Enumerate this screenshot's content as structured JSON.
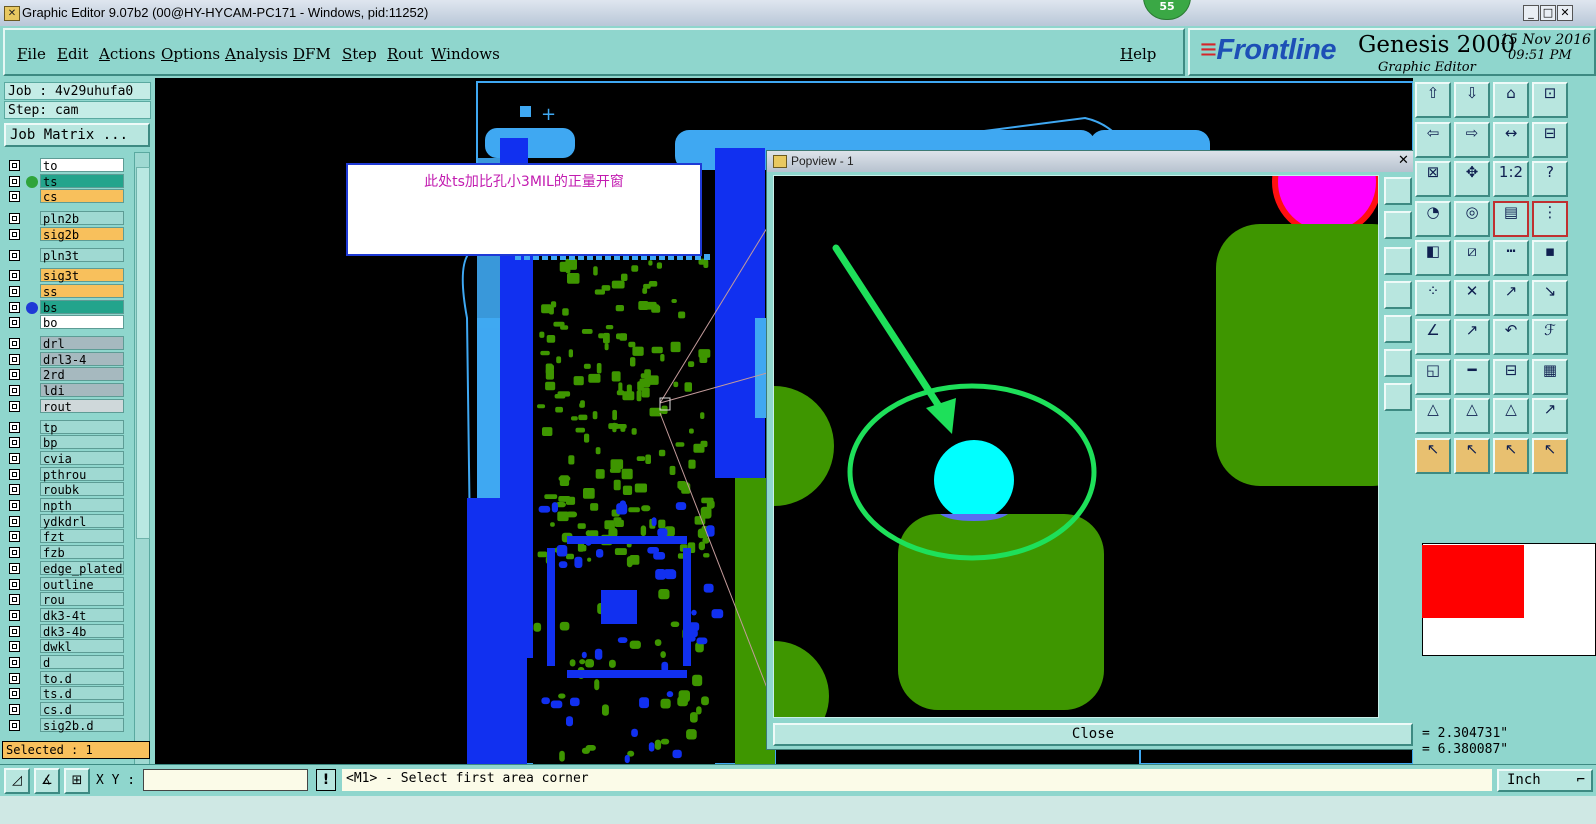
{
  "window": {
    "title": "Graphic Editor 9.07b2 (00@HY-HYCAM-PC171 - Windows, pid:11252)",
    "badge": "55",
    "min_icon": "minimize-icon",
    "max_icon": "maximize-icon",
    "close_icon": "close-icon"
  },
  "menu": {
    "items": [
      "File",
      "Edit",
      "Actions",
      "Options",
      "Analysis",
      "DFM",
      "Step",
      "Rout",
      "Windows"
    ],
    "help": "Help"
  },
  "brand": {
    "logo": "Frontline",
    "product": "Genesis 2000",
    "subtitle": "Graphic Editor",
    "date": "15 Nov 2016",
    "time": "09:51 PM"
  },
  "left": {
    "job": "Job : 4v29uhufa0",
    "step": "Step: cam",
    "job_matrix": "Job Matrix ...",
    "selected": "Selected : 1",
    "layers": [
      {
        "name": "to",
        "style": "white",
        "marker": ""
      },
      {
        "name": "ts",
        "style": "green",
        "marker": "#2fa43a"
      },
      {
        "name": "cs",
        "style": "orange",
        "marker": ""
      },
      {
        "name": "pln2b",
        "style": "teal",
        "marker": ""
      },
      {
        "name": "sig2b",
        "style": "orange",
        "marker": ""
      },
      {
        "name": "pln3t",
        "style": "teal",
        "marker": ""
      },
      {
        "name": "sig3t",
        "style": "orange",
        "marker": ""
      },
      {
        "name": "ss",
        "style": "orange",
        "marker": ""
      },
      {
        "name": "bs",
        "style": "green",
        "marker": "#1f3ad6"
      },
      {
        "name": "bo",
        "style": "white",
        "marker": ""
      },
      {
        "name": "drl",
        "style": "grey",
        "marker": ""
      },
      {
        "name": "drl3-4",
        "style": "grey",
        "marker": ""
      },
      {
        "name": "2rd",
        "style": "grey",
        "marker": ""
      },
      {
        "name": "ldi",
        "style": "grey",
        "marker": ""
      },
      {
        "name": "rout",
        "style": "lgrey",
        "marker": ""
      },
      {
        "name": "tp",
        "style": "teal",
        "marker": ""
      },
      {
        "name": "bp",
        "style": "teal",
        "marker": ""
      },
      {
        "name": "cvia",
        "style": "teal",
        "marker": ""
      },
      {
        "name": "pthrou",
        "style": "teal",
        "marker": ""
      },
      {
        "name": "roubk",
        "style": "teal",
        "marker": ""
      },
      {
        "name": "npth",
        "style": "teal",
        "marker": ""
      },
      {
        "name": "ydkdrl",
        "style": "teal",
        "marker": ""
      },
      {
        "name": "fzt",
        "style": "teal",
        "marker": ""
      },
      {
        "name": "fzb",
        "style": "teal",
        "marker": ""
      },
      {
        "name": "edge_plated",
        "style": "teal",
        "marker": ""
      },
      {
        "name": "outline",
        "style": "teal",
        "marker": ""
      },
      {
        "name": "rou",
        "style": "teal",
        "marker": ""
      },
      {
        "name": "dk3-4t",
        "style": "teal",
        "marker": ""
      },
      {
        "name": "dk3-4b",
        "style": "teal",
        "marker": ""
      },
      {
        "name": "dwkl",
        "style": "teal",
        "marker": ""
      },
      {
        "name": "d",
        "style": "teal",
        "marker": ""
      },
      {
        "name": "to.d",
        "style": "teal",
        "marker": ""
      },
      {
        "name": "ts.d",
        "style": "teal",
        "marker": ""
      },
      {
        "name": "cs.d",
        "style": "teal",
        "marker": ""
      },
      {
        "name": "sig2b.d",
        "style": "teal",
        "marker": ""
      }
    ]
  },
  "canvas": {
    "note": "此处ts加比孔小3MIL的正量开窗"
  },
  "popview": {
    "title": "Popview - 1",
    "close_label": "Close"
  },
  "coords": {
    "x": "= 2.304731\"",
    "y": "= 6.380087\""
  },
  "status": {
    "xy_label": "X Y :",
    "xy_value": "",
    "warn": "!",
    "prompt": "<M1> - Select first area corner",
    "units": "Inch"
  },
  "colors": {
    "panel": "#8fd6cd",
    "copper_green": "#3e9600",
    "signal_blue": "#1130f0",
    "light_blue": "#3fa8f2",
    "pad_cyan": "#00ffff",
    "highlight_green": "#1ee05a",
    "magenta": "#ff00ff",
    "swatch_red": "#ff0000"
  }
}
